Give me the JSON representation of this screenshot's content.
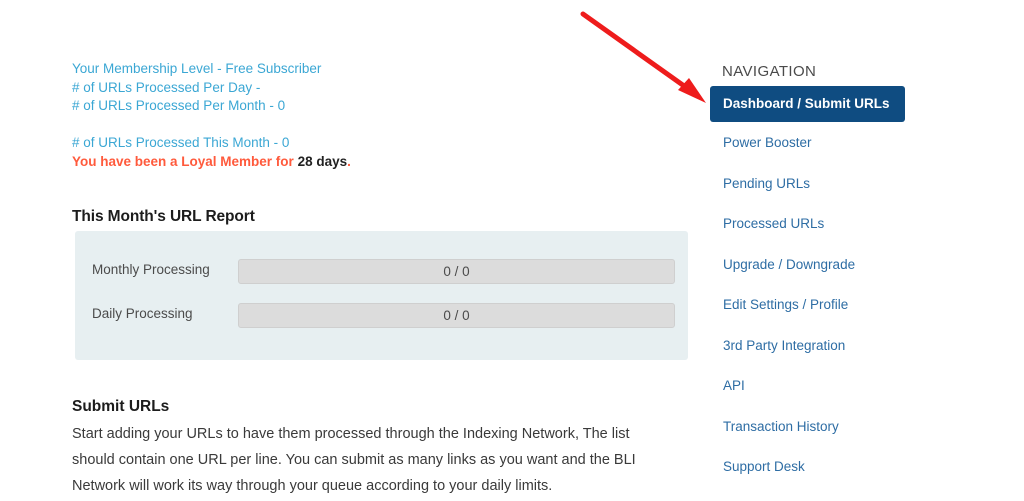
{
  "account": {
    "lines": [
      "Your Membership Level - Free Subscriber",
      "# of URLs Processed Per Day -",
      "# of URLs Processed Per Month - 0"
    ],
    "this_month_line": "# of URLs Processed This Month - 0",
    "loyal_prefix": "You have been a Loyal Member for ",
    "loyal_days": "28 days",
    "loyal_suffix": ".",
    "link_color": "#3ba7d4",
    "alert_color": "#ff5a3c"
  },
  "report": {
    "heading": "This Month's URL Report",
    "panel_color": "#e7eff1",
    "bar_color": "#dcdcdc",
    "rows": [
      {
        "label": "Monthly Processing",
        "value": "0 / 0"
      },
      {
        "label": "Daily Processing",
        "value": "0 / 0"
      }
    ]
  },
  "submit": {
    "heading": "Submit URLs",
    "body": "Start adding your URLs to have them processed through the Indexing Network, The list should contain one URL per line. You can submit as many links as you want and the BLI Network will work its way through your queue according to your daily limits."
  },
  "navigation": {
    "title": "NAVIGATION",
    "active_color": "#0f4c81",
    "link_color": "#2e6da4",
    "items": [
      {
        "label": "Dashboard / Submit URLs",
        "active": true
      },
      {
        "label": "Power Booster",
        "active": false
      },
      {
        "label": "Pending URLs",
        "active": false
      },
      {
        "label": "Processed URLs",
        "active": false
      },
      {
        "label": "Upgrade / Downgrade",
        "active": false
      },
      {
        "label": "Edit Settings / Profile",
        "active": false
      },
      {
        "label": "3rd Party Integration",
        "active": false
      },
      {
        "label": "API",
        "active": false
      },
      {
        "label": "Transaction History",
        "active": false
      },
      {
        "label": "Support Desk",
        "active": false
      }
    ]
  },
  "annotation": {
    "color": "#ee1c1c",
    "points_at": "Dashboard / Submit URLs"
  }
}
